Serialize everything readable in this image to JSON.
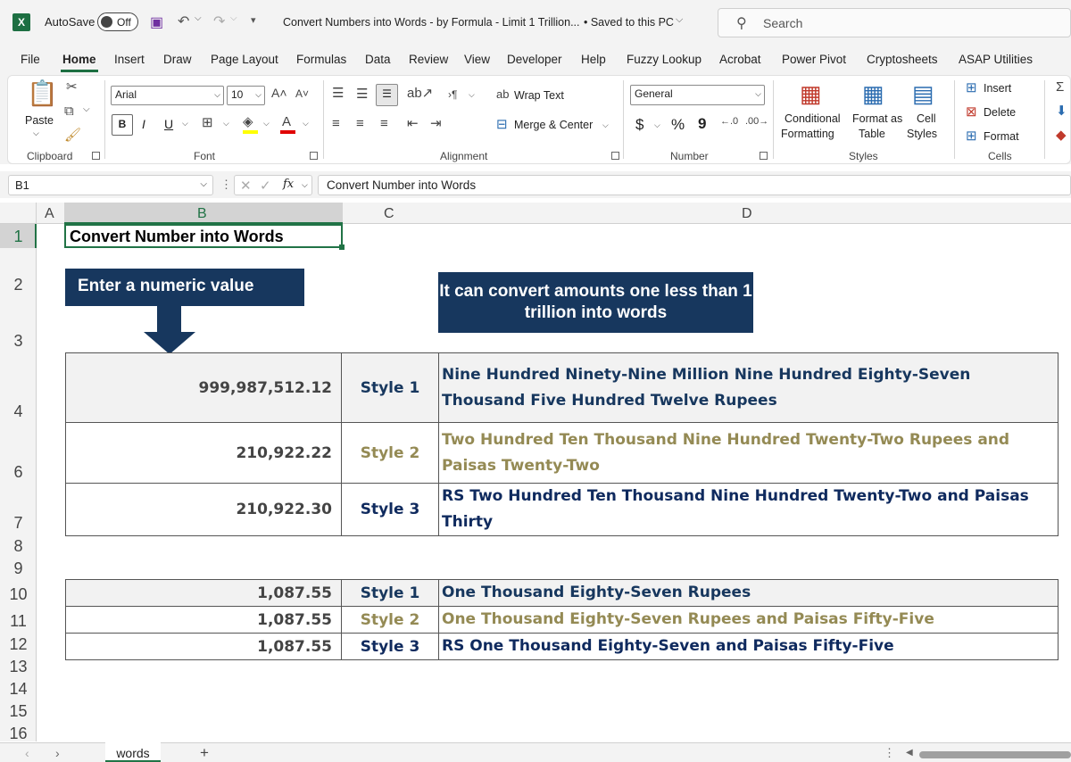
{
  "titlebar": {
    "autosave_label": "AutoSave",
    "autosave_state": "Off",
    "doc_title": "Convert Numbers into Words - by Formula - Limit 1 Trillion...",
    "save_status": "• Saved to this PC",
    "search_placeholder": "Search"
  },
  "menu": [
    "File",
    "Home",
    "Insert",
    "Draw",
    "Page Layout",
    "Formulas",
    "Data",
    "Review",
    "View",
    "Developer",
    "Help",
    "Fuzzy Lookup",
    "Acrobat",
    "Power Pivot",
    "Cryptosheets",
    "ASAP Utilities"
  ],
  "ribbon": {
    "clipboard": {
      "paste": "Paste",
      "label": "Clipboard"
    },
    "font": {
      "name": "Arial",
      "size": "10",
      "bold": "B",
      "italic": "I",
      "underline": "U",
      "label": "Font"
    },
    "alignment": {
      "wrap": "Wrap Text",
      "merge": "Merge & Center",
      "label": "Alignment"
    },
    "number": {
      "format": "General",
      "currency": "$",
      "percent": "%",
      "comma": "9",
      "label": "Number"
    },
    "styles": {
      "conditional": "Conditional",
      "conditional2": "Formatting",
      "format_as": "Format as",
      "format_as2": "Table",
      "cell": "Cell",
      "cell2": "Styles",
      "label": "Styles"
    },
    "cells": {
      "insert": "Insert",
      "delete": "Delete",
      "format": "Format",
      "label": "Cells"
    }
  },
  "formula_bar": {
    "name_box": "B1",
    "fx": "fx",
    "content": "Convert Number into Words"
  },
  "columns": [
    "A",
    "B",
    "C",
    "D"
  ],
  "rows": [
    "1",
    "2",
    "3",
    "4",
    "6",
    "7",
    "8",
    "9",
    "10",
    "11",
    "12",
    "13",
    "14",
    "15",
    "16"
  ],
  "sheet": {
    "b1_title": "Convert Number into Words",
    "callout_enter": "Enter a numeric value",
    "callout_info": "It can convert amounts one less than 1 trillion into words",
    "table1": [
      {
        "value": "999,987,512.12",
        "style": "Style 1",
        "words": "Nine Hundred Ninety-Nine Million Nine Hundred Eighty-Seven Thousand Five Hundred Twelve Rupees"
      },
      {
        "value": "210,922.22",
        "style": "Style 2",
        "words": "Two Hundred Ten Thousand Nine Hundred Twenty-Two Rupees and Paisas Twenty-Two"
      },
      {
        "value": "210,922.30",
        "style": "Style 3",
        "words": "RS Two Hundred Ten Thousand Nine Hundred Twenty-Two  and Paisas Thirty"
      }
    ],
    "table2": [
      {
        "value": "1,087.55",
        "style": "Style 1",
        "words": "One Thousand Eighty-Seven Rupees"
      },
      {
        "value": "1,087.55",
        "style": "Style 2",
        "words": "One Thousand Eighty-Seven Rupees and Paisas Fifty-Five"
      },
      {
        "value": "1,087.55",
        "style": "Style 3",
        "words": "RS One Thousand Eighty-Seven  and Paisas Fifty-Five"
      }
    ]
  },
  "tabs": {
    "sheet_name": "words",
    "add": "+"
  }
}
